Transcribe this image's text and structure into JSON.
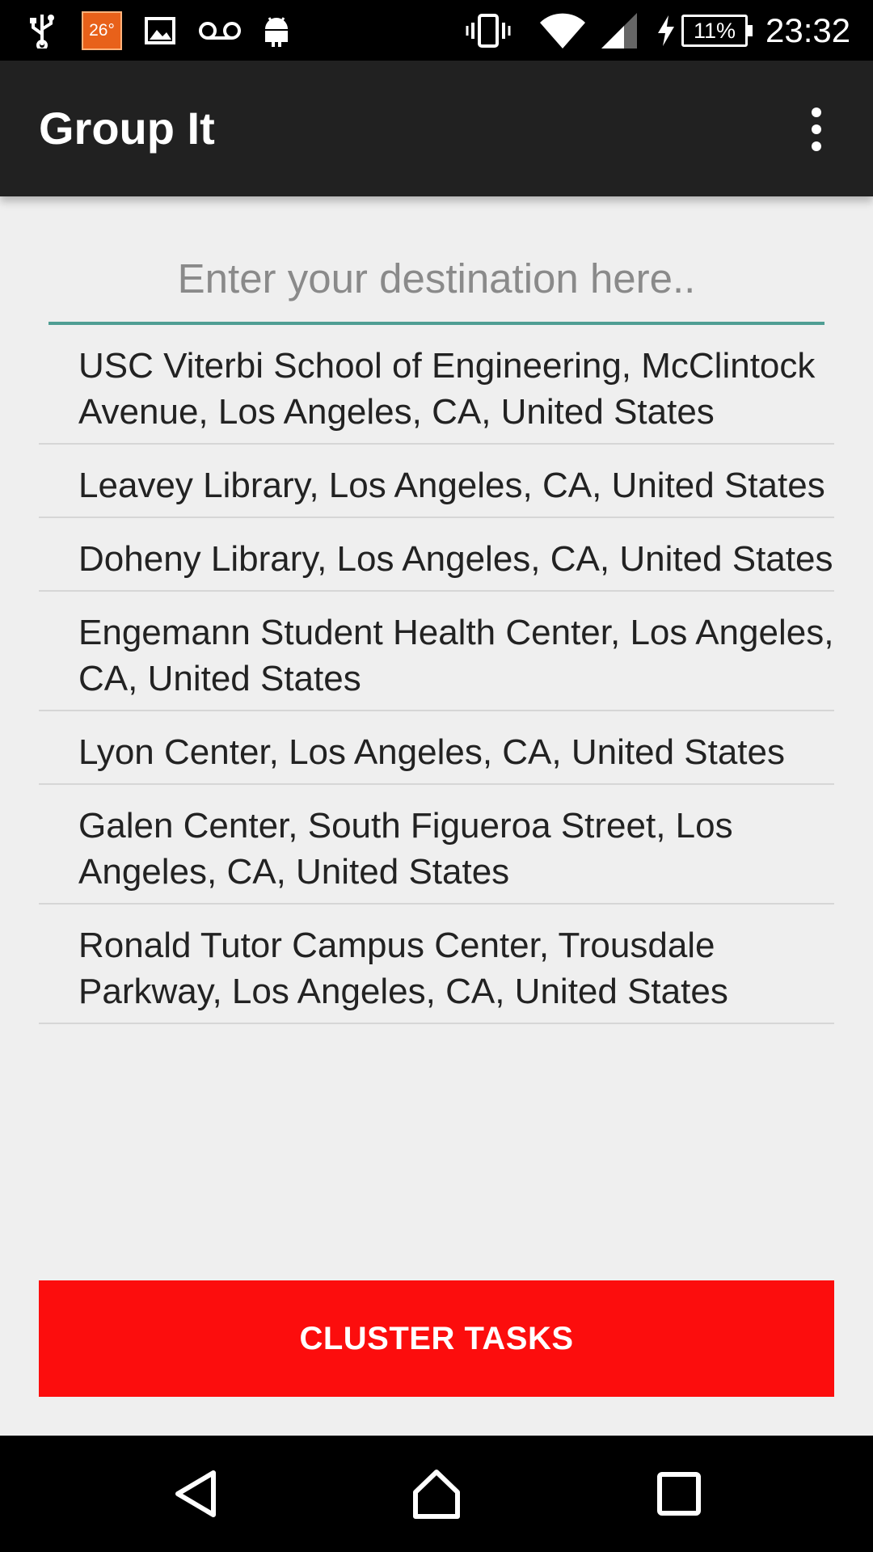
{
  "status_bar": {
    "badge_text": "26°",
    "battery_text": "11%",
    "time": "23:32",
    "icons": [
      "usb-icon",
      "temperature-badge",
      "image-icon",
      "voicemail-icon",
      "android-icon",
      "vibrate-icon",
      "wifi-icon",
      "signal-icon",
      "charging-icon",
      "battery-icon"
    ]
  },
  "app_bar": {
    "title": "Group It",
    "menu_icon": "overflow-menu-icon"
  },
  "destination": {
    "placeholder": "Enter your destination here..",
    "value": ""
  },
  "places": [
    "USC Viterbi School of Engineering, McClintock Avenue, Los Angeles, CA, United States",
    "Leavey Library, Los Angeles, CA, United States",
    "Doheny Library, Los Angeles, CA, United States",
    "Engemann Student Health Center, Los Angeles, CA, United States",
    "Lyon Center, Los Angeles, CA, United States",
    "Galen Center, South Figueroa Street, Los Angeles, CA, United States",
    "Ronald Tutor Campus Center, Trousdale Parkway, Los Angeles, CA, United States"
  ],
  "actions": {
    "cluster_label": "CLUSTER TASKS"
  },
  "colors": {
    "app_bar": "#212121",
    "accent_underline": "#4f9e94",
    "cluster_button": "#fc0d0d",
    "background": "#efefef"
  },
  "nav_bar": {
    "icons": [
      "back-icon",
      "home-icon",
      "recents-icon"
    ]
  }
}
